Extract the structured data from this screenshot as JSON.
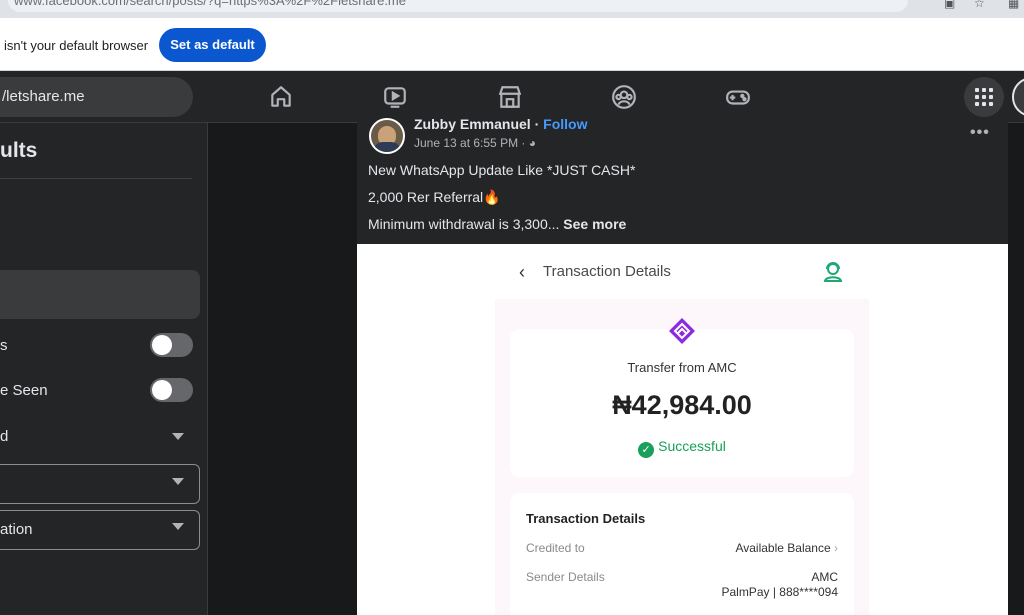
{
  "browser": {
    "url_fragment": "www.facebook.com/search/posts/?q=https%3A%2F%2Fletshare.me",
    "infobar": {
      "message": "isn't your default browser",
      "set_default_label": "Set as default"
    }
  },
  "fb_nav": {
    "search_text": "/letshare.me",
    "icons": [
      "home-icon",
      "video-icon",
      "marketplace-icon",
      "groups-icon",
      "gaming-icon",
      "menu-grid-icon"
    ]
  },
  "left_panel": {
    "title": "ults",
    "toggle_1_label": "s",
    "toggle_2_label": "e Seen",
    "dropdown_1_label": "d",
    "dropdown_3_label": "ation"
  },
  "post": {
    "author": "Zubby Emmanuel",
    "separator": " · ",
    "follow_label": "Follow",
    "timestamp": "June 13 at 6:55 PM",
    "audience_separator": " · ",
    "line1": "New WhatsApp Update Like *JUST CASH*",
    "line2": "2,000 Rer Referral🔥",
    "line3": "Minimum withdrawal is 3,300...",
    "see_more": "See more",
    "more_label": "•••"
  },
  "receipt": {
    "back_label": "‹",
    "header_title": "Transaction Details",
    "from_label": "Transfer from AMC",
    "amount": "₦42,984.00",
    "status_check": "✓",
    "status": "Successful",
    "details_title": "Transaction Details",
    "credited_to_label": "Credited to",
    "credited_to_value": "Available Balance",
    "sender_label": "Sender Details",
    "sender_value_1": "AMC",
    "sender_value_2": "PalmPay | 888****094",
    "colors": {
      "brand_purple": "#8a2be2",
      "success_green": "#19a05a",
      "support_teal": "#1ea974"
    }
  }
}
